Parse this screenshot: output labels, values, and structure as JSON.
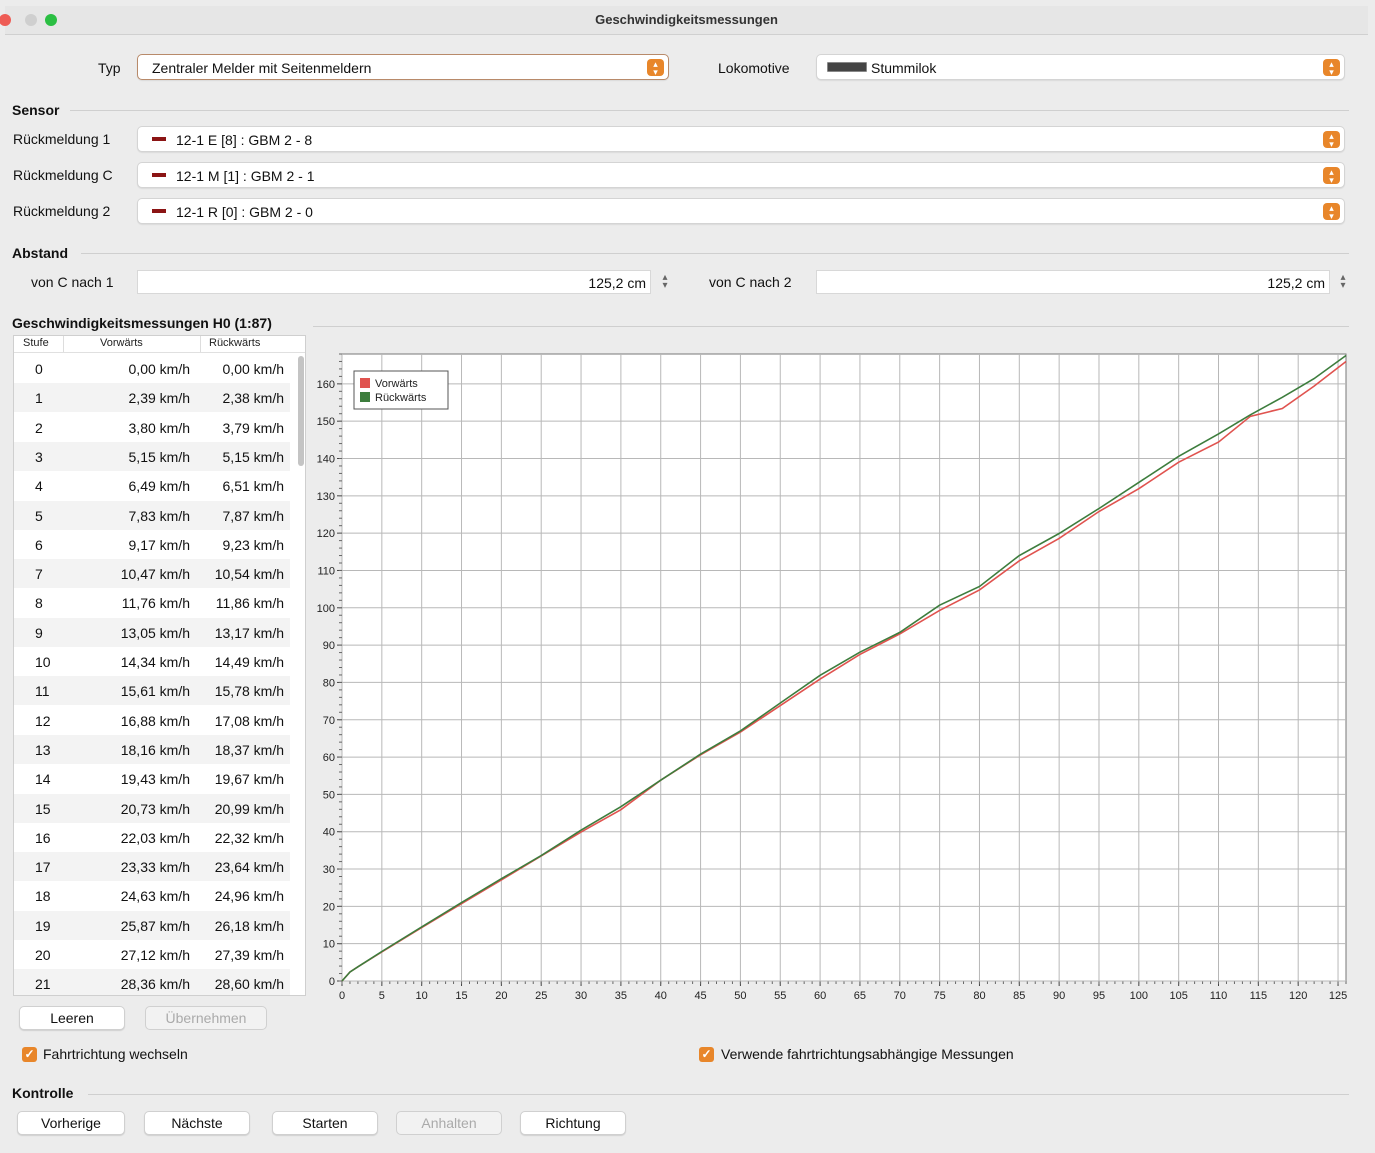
{
  "window": {
    "title": "Geschwindigkeitsmessungen"
  },
  "top": {
    "typ_label": "Typ",
    "typ_value": "Zentraler Melder mit Seitenmeldern",
    "lok_label": "Lokomotive",
    "lok_value": "Stummilok"
  },
  "sensor": {
    "section": "Sensor",
    "rows": [
      {
        "label": "Rückmeldung 1",
        "value": "12-1 E [8] : GBM 2 - 8"
      },
      {
        "label": "Rückmeldung C",
        "value": "12-1 M [1] : GBM 2 - 1"
      },
      {
        "label": "Rückmeldung 2",
        "value": "12-1 R [0] : GBM 2 - 0"
      }
    ]
  },
  "abstand": {
    "section": "Abstand",
    "c1_label": "von C nach 1",
    "c1_value": "125,2 cm",
    "c2_label": "von C nach 2",
    "c2_value": "125,2 cm"
  },
  "measure": {
    "section": "Geschwindigkeitsmessungen H0 (1:87)",
    "headers": [
      "Stufe",
      "Vorwärts",
      "Rückwärts"
    ],
    "rows": [
      [
        "0",
        "0,00 km/h",
        "0,00 km/h"
      ],
      [
        "1",
        "2,39 km/h",
        "2,38 km/h"
      ],
      [
        "2",
        "3,80 km/h",
        "3,79 km/h"
      ],
      [
        "3",
        "5,15 km/h",
        "5,15 km/h"
      ],
      [
        "4",
        "6,49 km/h",
        "6,51 km/h"
      ],
      [
        "5",
        "7,83 km/h",
        "7,87 km/h"
      ],
      [
        "6",
        "9,17 km/h",
        "9,23 km/h"
      ],
      [
        "7",
        "10,47 km/h",
        "10,54 km/h"
      ],
      [
        "8",
        "11,76 km/h",
        "11,86 km/h"
      ],
      [
        "9",
        "13,05 km/h",
        "13,17 km/h"
      ],
      [
        "10",
        "14,34 km/h",
        "14,49 km/h"
      ],
      [
        "11",
        "15,61 km/h",
        "15,78 km/h"
      ],
      [
        "12",
        "16,88 km/h",
        "17,08 km/h"
      ],
      [
        "13",
        "18,16 km/h",
        "18,37 km/h"
      ],
      [
        "14",
        "19,43 km/h",
        "19,67 km/h"
      ],
      [
        "15",
        "20,73 km/h",
        "20,99 km/h"
      ],
      [
        "16",
        "22,03 km/h",
        "22,32 km/h"
      ],
      [
        "17",
        "23,33 km/h",
        "23,64 km/h"
      ],
      [
        "18",
        "24,63 km/h",
        "24,96 km/h"
      ],
      [
        "19",
        "25,87 km/h",
        "26,18 km/h"
      ],
      [
        "20",
        "27,12 km/h",
        "27,39 km/h"
      ],
      [
        "21",
        "28,36 km/h",
        "28,60 km/h"
      ]
    ],
    "btn_clear": "Leeren",
    "btn_apply": "Übernehmen",
    "chk_direction": "Fahrtrichtung wechseln",
    "chk_directional": "Verwende fahrtrichtungsabhängige Messungen"
  },
  "kontrolle": {
    "section": "Kontrolle",
    "buttons": [
      "Vorherige",
      "Nächste",
      "Starten",
      "Anhalten",
      "Richtung"
    ]
  },
  "chart_data": {
    "type": "line",
    "xlim": [
      0,
      126
    ],
    "ylim": [
      0,
      168
    ],
    "xticks": [
      0,
      5,
      10,
      15,
      20,
      25,
      30,
      35,
      40,
      45,
      50,
      55,
      60,
      65,
      70,
      75,
      80,
      85,
      90,
      95,
      100,
      105,
      110,
      115,
      120,
      125
    ],
    "yticks": [
      0,
      10,
      20,
      30,
      40,
      50,
      60,
      70,
      80,
      90,
      100,
      110,
      120,
      130,
      140,
      150,
      160
    ],
    "grid": true,
    "legend": "top-left",
    "series": [
      {
        "name": "Vorwärts",
        "color": "#e0534f",
        "x": [
          0,
          1,
          2,
          5,
          10,
          15,
          20,
          25,
          30,
          35,
          40,
          45,
          50,
          55,
          60,
          65,
          70,
          75,
          80,
          85,
          90,
          95,
          100,
          105,
          110,
          114,
          118,
          122,
          126
        ],
        "y": [
          0,
          2.4,
          3.8,
          7.8,
          14.3,
          20.7,
          27.1,
          33.5,
          39.9,
          45.9,
          53.8,
          60.6,
          66.7,
          73.8,
          80.9,
          87.5,
          93.0,
          99.3,
          104.8,
          112.6,
          118.6,
          125.8,
          131.9,
          139.0,
          144.4,
          151.3,
          153.4,
          159.4,
          166.0
        ]
      },
      {
        "name": "Rückwärts",
        "color": "#3d7d3d",
        "x": [
          0,
          1,
          2,
          5,
          10,
          15,
          20,
          25,
          30,
          35,
          40,
          45,
          50,
          55,
          60,
          65,
          70,
          75,
          80,
          85,
          90,
          95,
          100,
          105,
          110,
          114,
          118,
          122,
          126
        ],
        "y": [
          0,
          2.4,
          3.8,
          7.9,
          14.5,
          21.0,
          27.4,
          33.6,
          40.4,
          46.7,
          53.8,
          60.8,
          67.0,
          74.5,
          81.9,
          88.1,
          93.4,
          100.7,
          105.7,
          114.0,
          119.9,
          126.6,
          133.6,
          140.6,
          146.6,
          151.7,
          156.4,
          161.4,
          167.6
        ]
      }
    ]
  }
}
